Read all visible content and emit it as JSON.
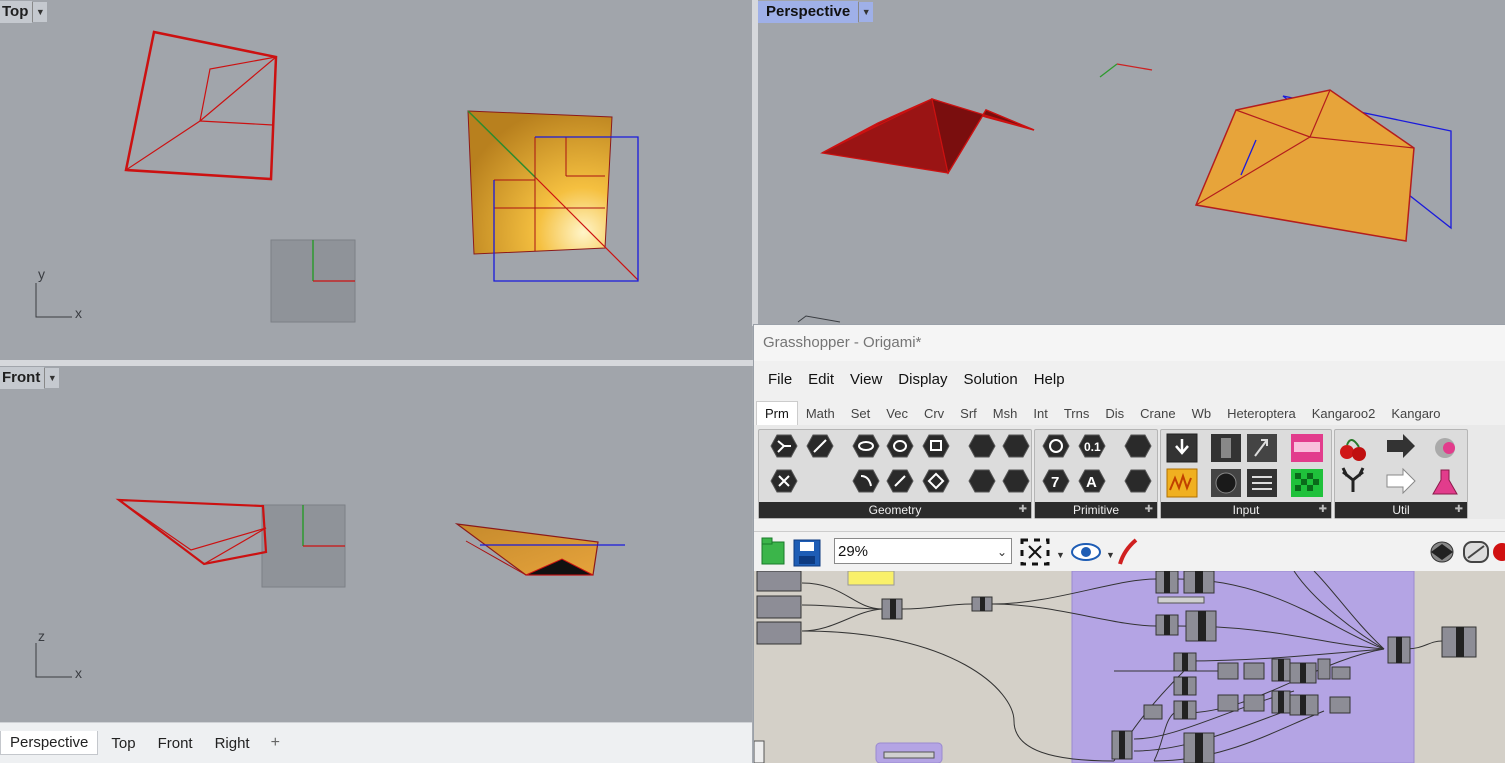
{
  "viewports": {
    "top": {
      "name": "Top",
      "axis_v": "y",
      "axis_h": "x"
    },
    "perspective": {
      "name": "Perspective"
    },
    "front": {
      "name": "Front",
      "axis_v": "z",
      "axis_h": "x"
    }
  },
  "bottom_tabs": [
    "Perspective",
    "Top",
    "Front",
    "Right"
  ],
  "grasshopper": {
    "title": "Grasshopper - Origami*",
    "menu": [
      "File",
      "Edit",
      "View",
      "Display",
      "Solution",
      "Help"
    ],
    "tabs": [
      "Prm",
      "Math",
      "Set",
      "Vec",
      "Crv",
      "Srf",
      "Msh",
      "Int",
      "Trns",
      "Dis",
      "Crane",
      "Wb",
      "Heteroptera",
      "Kangaroo2",
      "Kangaro"
    ],
    "active_tab": "Prm",
    "panels": [
      "Geometry",
      "Primitive",
      "Input",
      "Util"
    ],
    "zoom": "29%"
  },
  "colors": {
    "viewport_bg": "#a1a5ab",
    "curve": "#cc1111",
    "surface": "#e7a43a",
    "canvas_bg": "#d4d0c8",
    "group": "#b4a4e4"
  }
}
